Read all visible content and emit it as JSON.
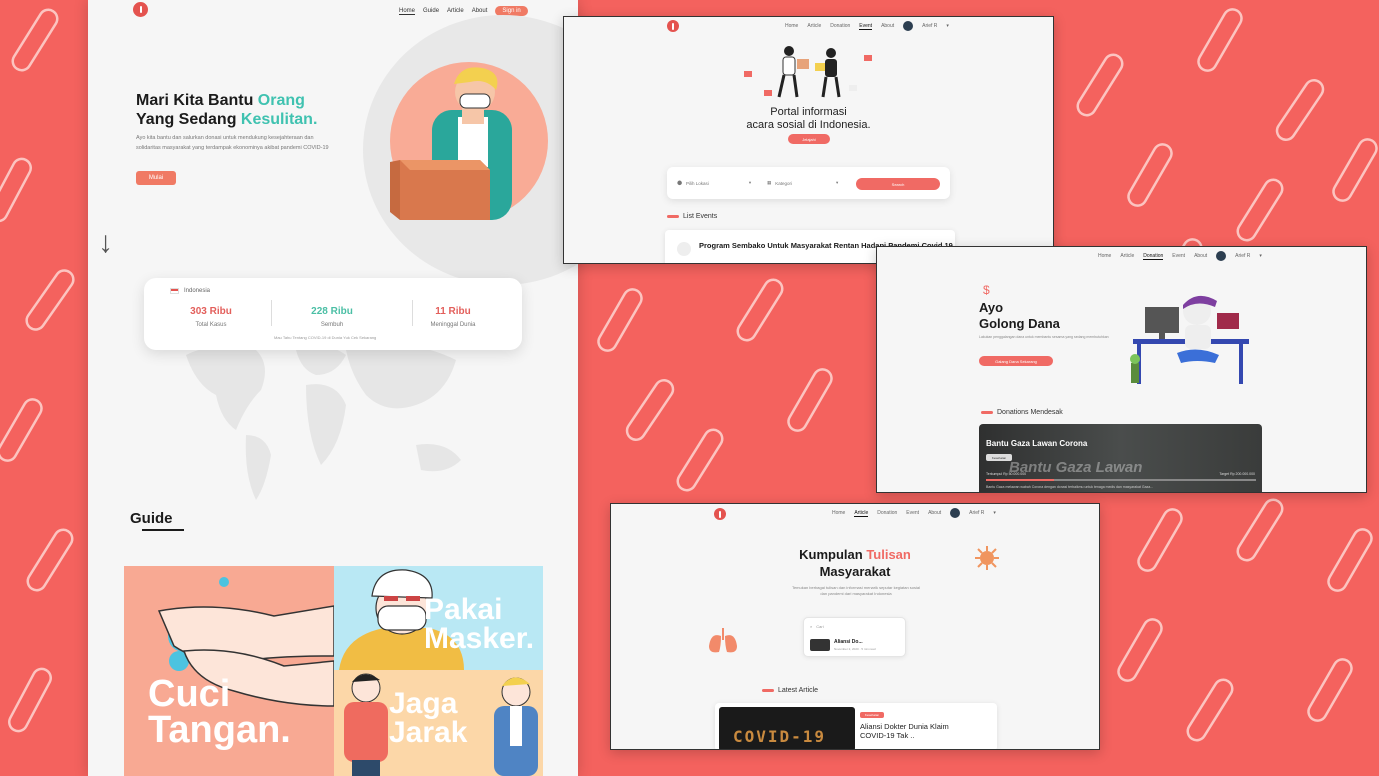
{
  "main": {
    "nav": {
      "home": "Home",
      "guide": "Guide",
      "article": "Article",
      "about": "About",
      "sign_in": "Sign in"
    },
    "hero": {
      "line1_dark": "Mari Kita Bantu ",
      "line1_teal": "Orang",
      "line2_dark": "Yang Sedang ",
      "line2_teal": "Kesulitan.",
      "description": "Ayo kita bantu dan salurkan donasi untuk mendukung kesejahteraan dan solidaritas masyarakat yang terdampak ekonominya akibat pandemi COVID-19",
      "cta": "Mulai"
    },
    "stats": {
      "country": "Indonesia",
      "items": [
        {
          "value": "303 Ribu",
          "label": "Total Kasus"
        },
        {
          "value": "228 Ribu",
          "label": "Sembuh"
        },
        {
          "value": "11 Ribu",
          "label": "Meninggal Dunia"
        }
      ],
      "source": "Mau Tahu Tentang COVID-19 di Dunia Yuk Cek Sekarang",
      "colors": [
        "#e35f5b",
        "#4bbfa5",
        "#e35f5b"
      ]
    },
    "guide": {
      "title": "Guide",
      "tiles": {
        "wash": "Cuci Tangan.",
        "mask": "Pakai Masker.",
        "distance": "Jaga Jarak"
      }
    }
  },
  "events": {
    "nav": {
      "home": "Home",
      "article": "Article",
      "donation": "Donation",
      "event": "Event",
      "about": "About",
      "user": "Arief R"
    },
    "title_line1": "Portal informasi",
    "title_line2": "acara sosial di Indonesia.",
    "cta": "Jelajahi",
    "search": {
      "location": "Pilih Lokasi",
      "category": "Kategori",
      "button": "Search"
    },
    "section": "List Events",
    "card": {
      "title": "Program Sembako Untuk Masyarakat Rentan Hadapi Pandemi Covid 19",
      "tag": "Donasi"
    }
  },
  "donation": {
    "nav": {
      "home": "Home",
      "article": "Article",
      "donation": "Donation",
      "event": "Event",
      "about": "About",
      "user": "Arief R"
    },
    "title_line1": "Ayo",
    "title_line2": "Golong Dana",
    "description": "Lakukan penggalangan dana untuk membantu sesama yang sedang membutuhkan",
    "cta": "Galang Dana Sekarang",
    "section": "Donations Mendesak",
    "card": {
      "title": "Bantu Gaza Lawan Corona",
      "watermark": "Bantu Gaza Lawan",
      "tag": "Kesehatan",
      "collected": "Terkumpul Rp 50.000.000",
      "target": "Target Rp 200.000.000",
      "bottom": "Bantu Gaza melawan wabah Corona dengan donasi terbaikmu untuk tenaga medis dan masyarakat Gaza..."
    }
  },
  "articles": {
    "nav": {
      "home": "Home",
      "article": "Article",
      "donation": "Donation",
      "event": "Event",
      "about": "About",
      "user": "Arief R"
    },
    "title_part1": "Kumpulan ",
    "title_part2": "Tulisan",
    "title_part3": "Masyarakat",
    "description": "Temukan berbagai tulisan dan informasi menarik seputar kegiatan sosial dan pandemi dari masyarakat Indonesia",
    "search_placeholder": "Cari",
    "result": {
      "title": "Aliansi Do...",
      "meta": "November 2, 2020 · 5 min read"
    },
    "section": "Latest Article",
    "latest": {
      "tag": "Kesehatan",
      "line1": "Aliansi Dokter Dunia Klaim",
      "line2": "COVID-19 Tak ..",
      "image_text": "COVID-19"
    }
  }
}
